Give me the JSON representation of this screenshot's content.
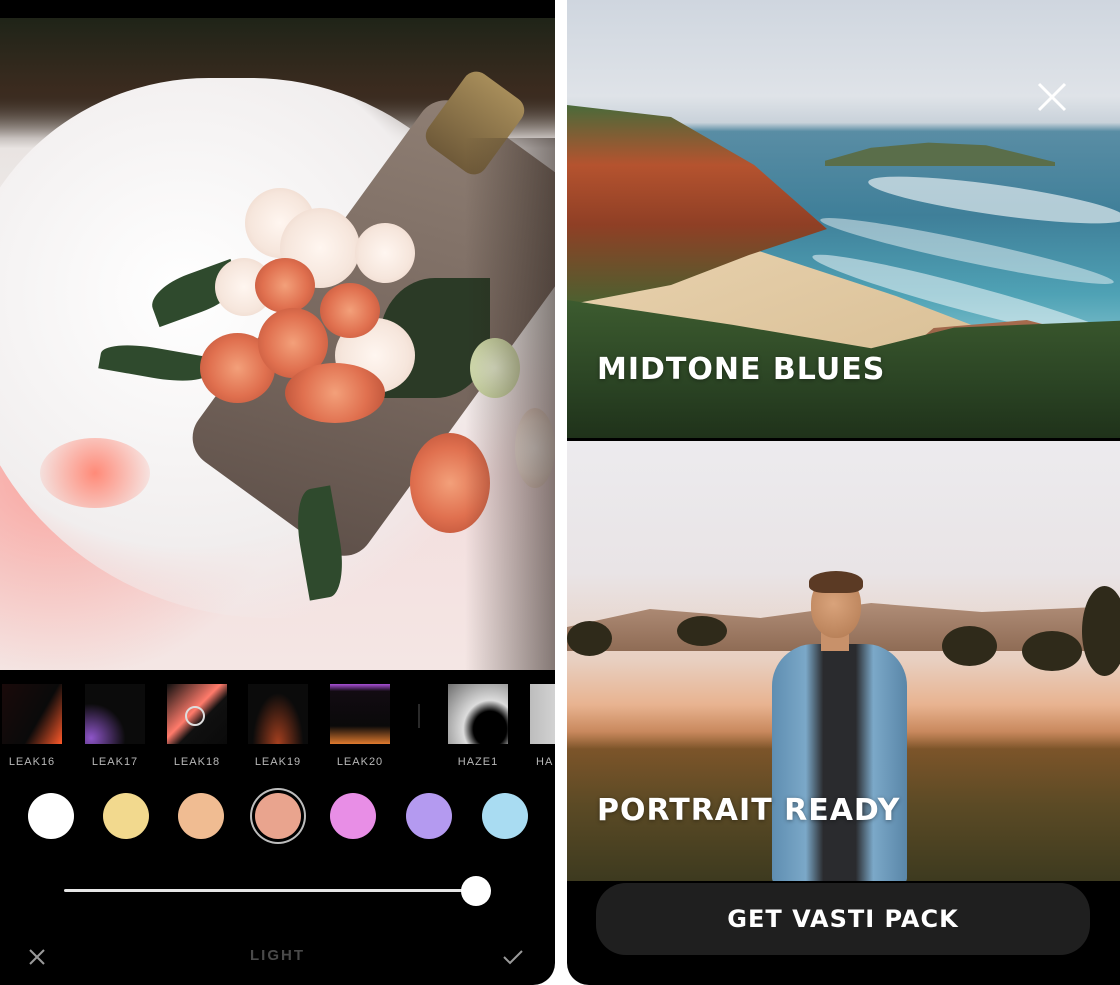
{
  "editor": {
    "filters": [
      {
        "label": "LEAK16"
      },
      {
        "label": "LEAK17"
      },
      {
        "label": "LEAK18"
      },
      {
        "label": "LEAK19"
      },
      {
        "label": "LEAK20"
      },
      {
        "label": "HAZE1"
      },
      {
        "label": "HA"
      }
    ],
    "swatches": [
      {
        "name": "white",
        "color": "#ffffff"
      },
      {
        "name": "yellow",
        "color": "#f2d98e"
      },
      {
        "name": "peach",
        "color": "#f0bc92"
      },
      {
        "name": "salmon",
        "color": "#e9a48e"
      },
      {
        "name": "pink",
        "color": "#e88ee6"
      },
      {
        "name": "lavender",
        "color": "#b49af0"
      },
      {
        "name": "light-blue",
        "color": "#a9dcf2"
      }
    ],
    "selected_swatch": "salmon",
    "intensity": 1.0,
    "mode_label": "LIGHT",
    "cancel_icon": "close-icon",
    "confirm_icon": "check-icon"
  },
  "pack_preview": {
    "cards": [
      {
        "title": "MIDTONE BLUES"
      },
      {
        "title": "PORTRAIT READY"
      }
    ],
    "close_icon": "close-icon",
    "cta_label": "GET VASTI PACK"
  }
}
